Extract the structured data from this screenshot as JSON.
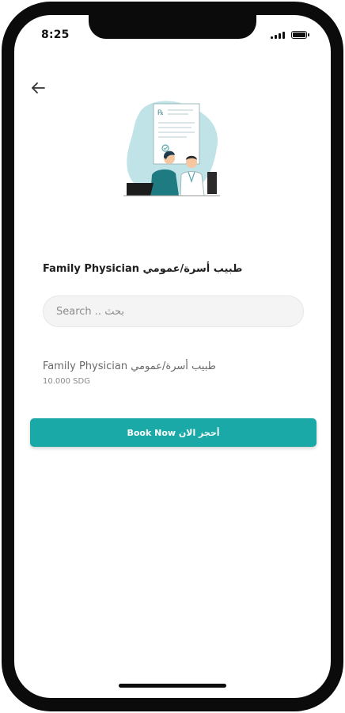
{
  "status_bar": {
    "time": "8:25"
  },
  "icons": {
    "back": "arrow-left-icon",
    "signal": "cellular-signal-icon",
    "battery": "battery-icon",
    "illustration": "doctor-consultation-illustration"
  },
  "colors": {
    "accent": "#1BA9A8",
    "illustration_blob": "#BFE3E6",
    "frame": "#0B0B0B"
  },
  "page": {
    "title": "Family Physician طبيب أسرة/عمومي"
  },
  "search": {
    "placeholder": "Search .. بحث",
    "value": ""
  },
  "results": [
    {
      "name": "Family Physician طبيب أسرة/عمومي",
      "price": "10.000 SDG"
    }
  ],
  "actions": {
    "book_now": "Book Now أحجز الان"
  }
}
